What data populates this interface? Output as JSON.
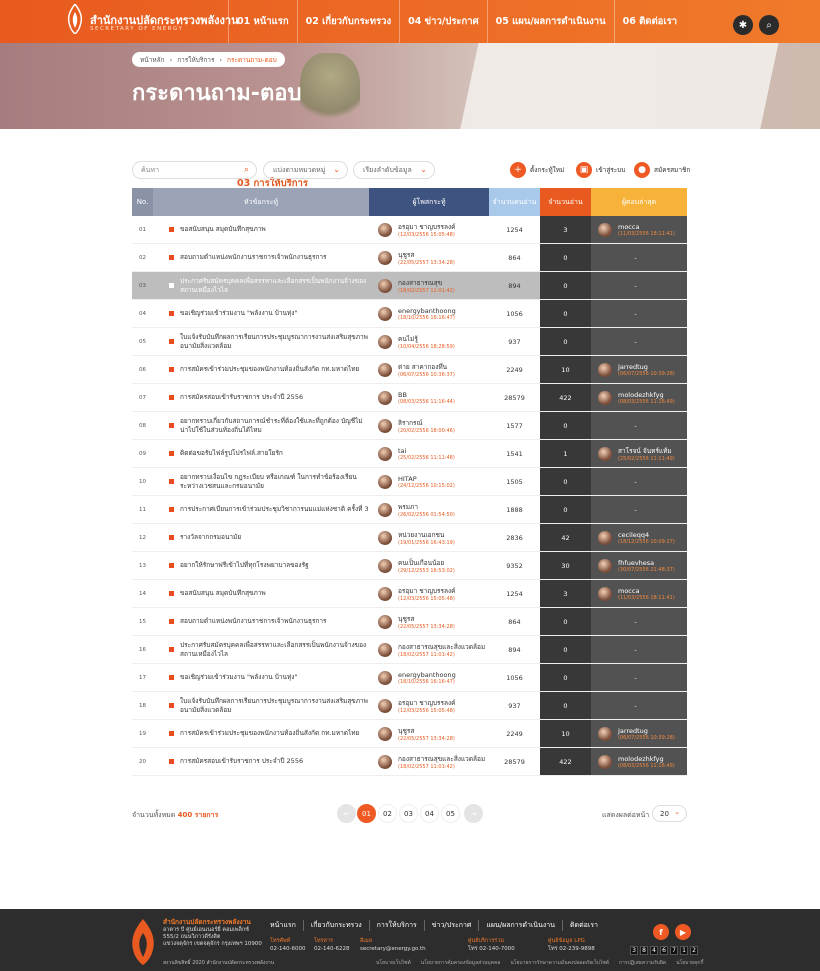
{
  "header": {
    "org_name": "สำนักงานปลัดกระทรวงพลังงาน",
    "org_name_en": "SECRETARY OF ENERGY",
    "nav": [
      {
        "label": "01 หน้าแรก"
      },
      {
        "label": "02 เกี่ยวกับกระทรวง"
      },
      {
        "label": "03 การให้บริการ"
      },
      {
        "label": "04 ข่าว/ประกาศ"
      },
      {
        "label": "05 แผน/ผลการดำเนินงาน"
      },
      {
        "label": "06 ติดต่อเรา"
      }
    ],
    "active_nav": 2,
    "accessibility_icon": "accessibility-icon",
    "search_icon": "search-icon",
    "accent": "#e85a1f"
  },
  "breadcrumb": [
    "หน้าหลัก",
    "การให้บริการ",
    "กระดานถาม-ตอบ"
  ],
  "page_title": "กระดานถาม-ตอบ",
  "toolbar": {
    "search_placeholder": "ค้นหา",
    "category_select": "แบ่งตามหมวดหมู่",
    "sort_select": "เรียงลำดับข้อมูล",
    "new_topic": "ตั้งกระทู้ใหม่",
    "login": "เข้าสู่ระบบ",
    "register": "สมัครสมาชิก"
  },
  "table": {
    "headers": {
      "no": "No.",
      "title": "หัวข้อกระทู้",
      "by": "ผู้โพสกระทู้",
      "views": "จำนวนคนอ่าน",
      "replies": "จำนวนอ่าน",
      "last": "ผู้ตอบล่าสุด"
    },
    "header_colors": {
      "no": "#8a93a6",
      "title": "#9aa4b6",
      "by": "#3f5380",
      "views": "#a9c9ea",
      "replies": "#e85a1f",
      "last": "#f7b23a"
    },
    "rows": [
      {
        "no": "01",
        "title": "ขอสนับสนุน สมุดบันทึกสุขภาพ",
        "by": "อรอุมา ชาญบรรลงค์",
        "date": "(12/03/2556 15:05:48)",
        "views": "1254",
        "replies": "3",
        "last_name": "mocca",
        "last_date": "(11/03/2556 18:11:41)",
        "gray": false
      },
      {
        "no": "02",
        "title": "สอบถามตำแหน่งพนักงานราชการเจ้าพนักงานธุรการ",
        "by": "นุชูรส",
        "date": "(22/05/2557 13:34:28)",
        "views": "864",
        "replies": "0",
        "last_name": "-",
        "last_date": "",
        "gray": false
      },
      {
        "no": "03",
        "title": "ประกาศรับสมัครบุคคลเพื่อสรรหาและเลือกสรรเป็นพนักงานจ้างของสถานเหมืองไวไล",
        "by": "กองสาธารณสุข",
        "date": "(18/02/2557 11:01:42)",
        "views": "894",
        "replies": "0",
        "last_name": "-",
        "last_date": "",
        "gray": true
      },
      {
        "no": "04",
        "title": "ขอเชิญร่วมเข้าร่วมงาน \"พลังงาน บ้านทุ่ง\"",
        "by": "energybanthoong",
        "date": "(18/10/2556 16:16:47)",
        "views": "1056",
        "replies": "0",
        "last_name": "-",
        "last_date": "",
        "gray": false
      },
      {
        "no": "05",
        "title": "ใบแจ้งรับบันทึกผลการเรียนการประชุมบูรณาการงานส่งเสริมสุขภาพอนามัยสิ่งแวดล้อม",
        "by": "คนไม่รู้",
        "date": "(10/04/2556 18:28:59)",
        "views": "937",
        "replies": "0",
        "last_name": "-",
        "last_date": "",
        "gray": false
      },
      {
        "no": "06",
        "title": "การสมัครเข้าร่วมประชุมของพนักงานท้องถิ่นสังกัด กท.มหาดไทย",
        "by": "ต่าย สาคากองทึ่น",
        "date": "(06/07/2556 10:36:37)",
        "views": "2249",
        "replies": "10",
        "last_name": "Jarredtug",
        "last_date": "(06/07/2556 10:39:28)",
        "gray": false
      },
      {
        "no": "07",
        "title": "การสมัครสอบเข้ารับราชการ ประจำปี 2556",
        "by": "BB",
        "date": "(08/03/2556 11:16:44)",
        "views": "28579",
        "replies": "422",
        "last_name": "molodezhkfyg",
        "last_date": "(08/03/2556 11:16:49)",
        "gray": false
      },
      {
        "no": "08",
        "title": "อยากทราบเกี่ยวกับสถานการณ์ชำระที่ต้องใช้และที่ถูกต้อง บัญชีไม่น่าไปใช้ในส่วนท้องถิ่นได้ไหม",
        "by": "สิรากรณ์",
        "date": "(20/02/2556 18:00:46)",
        "views": "1577",
        "replies": "0",
        "last_name": "-",
        "last_date": "",
        "gray": false
      },
      {
        "no": "09",
        "title": "ติดต่อขอรับไฟล์รูปโปรไฟล์.สายใยรัก",
        "by": "tai",
        "date": "(25/02/2556 11:11:48)",
        "views": "1541",
        "replies": "1",
        "last_name": "สาโรจน์ จันทร์แท้ม",
        "last_date": "(25/02/2556 11:11:49)",
        "gray": false
      },
      {
        "no": "10",
        "title": "อยากทราบเงื่อนไข กฎระเบียบ หรือเกณฑ์ ในการทำข้อร้องเรียนระหว่างเวชสนและกรมอนามัย",
        "by": "HITAP",
        "date": "(24/12/2556 10:15:02)",
        "views": "1505",
        "replies": "0",
        "last_name": "-",
        "last_date": "",
        "gray": false
      },
      {
        "no": "11",
        "title": "การประกาศเบียนการเข้าร่วมประชุมวิชาการนมแม่แห่งชาติ ครั้งที่ 3",
        "by": "พรมภา",
        "date": "(26/02/2556 01:54:50)",
        "views": "1888",
        "replies": "0",
        "last_name": "-",
        "last_date": "",
        "gray": false
      },
      {
        "no": "12",
        "title": "รางวัลจากกรมอนามัย",
        "by": "หน่วยงานเอกชน",
        "date": "(19/01/2556 16:43:19)",
        "views": "2836",
        "replies": "42",
        "last_name": "cecileqq4",
        "last_date": "(18/12/2556 10:09:27)",
        "gray": false
      },
      {
        "no": "13",
        "title": "อยากให้รักษาฟรีเข้าไปที่ทุกโรงพยาบาลของรัฐ",
        "by": "คนเป็นเกือนน้อย",
        "date": "(29/12/2553 16:53:02)",
        "views": "9352",
        "replies": "30",
        "last_name": "fhfuevhesa",
        "last_date": "(30/07/2556 21:48:37)",
        "gray": false
      },
      {
        "no": "14",
        "title": "ขอสนับสนุน สมุดบันทึกสุขภาพ",
        "by": "อรอุมา ชาญบรรลงค์",
        "date": "(12/03/2556 15:05:48)",
        "views": "1254",
        "replies": "3",
        "last_name": "mocca",
        "last_date": "(11/03/2556 18:11:41)",
        "gray": false
      },
      {
        "no": "15",
        "title": "สอบถามตำแหน่งพนักงานราชการเจ้าพนักงานธุรการ",
        "by": "นุชูรส",
        "date": "(22/05/2557 13:34:28)",
        "views": "864",
        "replies": "0",
        "last_name": "-",
        "last_date": "",
        "gray": false
      },
      {
        "no": "16",
        "title": "ประกาศรับสมัครบุคคลเพื่อสรรหาและเลือกสรรเป็นพนักงานจ้างของสถานเหมืองไวไล",
        "by": "กองสาธารณสุขและสิ่งแวดล้อม",
        "date": "(18/02/2557 11:01:42)",
        "views": "894",
        "replies": "0",
        "last_name": "-",
        "last_date": "",
        "gray": false
      },
      {
        "no": "17",
        "title": "ขอเชิญร่วมเข้าร่วมงาน \"พลังงาน บ้านทุ่ง\"",
        "by": "energybanthoong",
        "date": "(18/10/2556 16:16:47)",
        "views": "1056",
        "replies": "0",
        "last_name": "-",
        "last_date": "",
        "gray": false
      },
      {
        "no": "18",
        "title": "ใบแจ้งรับบันทึกผลการเรียนการประชุมบูรณาการงานส่งเสริมสุขภาพอนามัยสิ่งแวดล้อม",
        "by": "อรอุมา ชาญบรรลงค์",
        "date": "(12/03/2556 15:05:48)",
        "views": "937",
        "replies": "0",
        "last_name": "-",
        "last_date": "",
        "gray": false
      },
      {
        "no": "19",
        "title": "การสมัครเข้าร่วมประชุมของพนักงานท้องถิ่นสังกัด กท.มหาดไทย",
        "by": "นุชูรส",
        "date": "(22/05/2557 13:34:28)",
        "views": "2249",
        "replies": "10",
        "last_name": "Jarredtug",
        "last_date": "(06/07/2556 10:39:28)",
        "gray": false
      },
      {
        "no": "20",
        "title": "การสมัครสอบเข้ารับราชการ ประจำปี 2556",
        "by": "กองสาธารณสุขและสิ่งแวดล้อม",
        "date": "(18/02/2557 11:01:42)",
        "views": "28579",
        "replies": "422",
        "last_name": "molodezhkfyg",
        "last_date": "(08/03/2556 11:16:49)",
        "gray": false
      }
    ]
  },
  "pagination": {
    "total_label": "จำนวนทั้งหมด",
    "total_count": "400 รายการ",
    "pages": [
      "01",
      "02",
      "03",
      "04",
      "05"
    ],
    "current": "01",
    "per_page_label": "แสดงผลต่อหน้า",
    "per_page": "20"
  },
  "footer": {
    "org_name": "สำนักงานปลัดกระทรวงพลังงาน",
    "address": [
      "อาคาร บี ศูนย์เอนเนอร์ยี่ คอมเพล็กซ์",
      "555/2 ถนนวิภาวดีรังสิต",
      "แขวงจตุจักร เขตจตุจักร กรุงเทพฯ 10900"
    ],
    "copyright": "สงวนลิขสิทธิ์ 2020 สำนักงานปลัดกระทรวงพลังงาน",
    "nav": [
      "หน้าแรก",
      "เกี่ยวกับกระทรวง",
      "การให้บริการ",
      "ข่าว/ประกาศ",
      "แผน/ผลการดำเนินงาน",
      "ติดต่อเรา"
    ],
    "phone_label": "โทรศัพท์",
    "phone": "02-140-6000",
    "fax_label": "โทรสาร",
    "fax": "02-140-6228",
    "email_label": "อีเมล",
    "email": "secretary@energy.go.th",
    "center_label": "ศูนย์บริการร่วม",
    "center": "โทร 02-140-7000",
    "lpg_label": "ศูนย์ข้อมูล LPG",
    "lpg": "โทร 02-239-9898",
    "sub_links": [
      "นโยบายเว็บไซต์",
      "นโยบายการคุ้มครองข้อมูลส่วนบุคคล",
      "นโยบายการรักษาความมั่นคงปลอดภัยเว็บไซต์",
      "การปฏิเสธความรับผิด",
      "นโยบายคุกกี้"
    ],
    "counter": [
      "3",
      "8",
      "4",
      "6",
      "7",
      "1",
      "2"
    ],
    "facebook_icon": "facebook-icon",
    "youtube_icon": "youtube-icon"
  }
}
